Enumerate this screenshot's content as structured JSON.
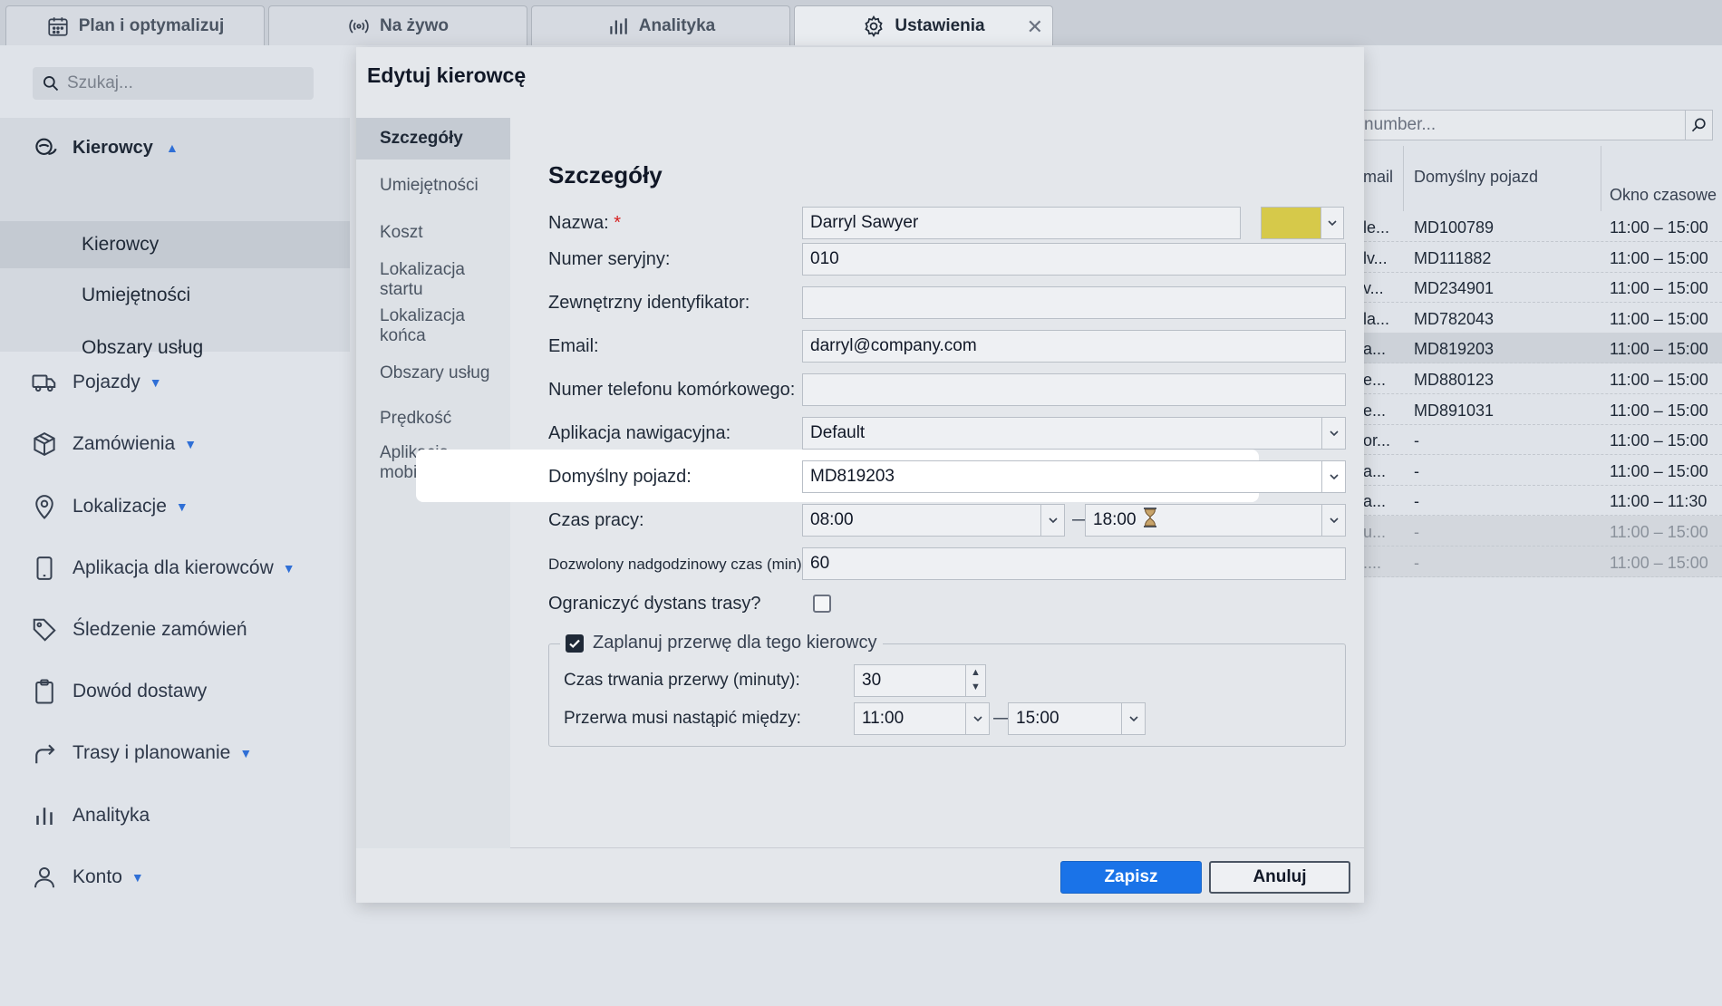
{
  "tabs": [
    {
      "label": "Plan i optymalizuj",
      "icon": "calendar-icon"
    },
    {
      "label": "Na żywo",
      "icon": "broadcast-icon"
    },
    {
      "label": "Analityka",
      "icon": "bar-chart-icon"
    },
    {
      "label": "Ustawienia",
      "icon": "gear-icon",
      "close": "✕"
    }
  ],
  "sidebar": {
    "search_placeholder": "Szukaj...",
    "drivers_label": "Kierowcy",
    "drivers_sub": [
      "Kierowcy",
      "Umiejętności",
      "Obszary usług"
    ],
    "items": [
      {
        "label": "Pojazdy",
        "icon": "truck-icon",
        "caret": true
      },
      {
        "label": "Zamówienia",
        "icon": "box-icon",
        "caret": true
      },
      {
        "label": "Lokalizacje",
        "icon": "map-pin-icon",
        "caret": true
      },
      {
        "label": "Aplikacja dla kierowców",
        "icon": "phone-icon",
        "caret": true
      },
      {
        "label": "Śledzenie zamówień",
        "icon": "tag-icon",
        "caret": false
      },
      {
        "label": "Dowód dostawy",
        "icon": "clipboard-icon",
        "caret": false
      },
      {
        "label": "Trasy i planowanie",
        "icon": "route-arrow-icon",
        "caret": true
      },
      {
        "label": "Analityka",
        "icon": "bar-chart-icon",
        "caret": false
      },
      {
        "label": "Konto",
        "icon": "user-icon",
        "caret": true
      }
    ]
  },
  "bg_table": {
    "search_placeholder": "number...",
    "headers": {
      "email": "mail",
      "vehicle": "Domyślny pojazd",
      "window": "Okno czasowe"
    },
    "rows": [
      {
        "email": "le...",
        "vehicle": "MD100789",
        "window": "11:00 – 15:00"
      },
      {
        "email": "lv...",
        "vehicle": "MD111882",
        "window": "11:00 – 15:00"
      },
      {
        "email": "v...",
        "vehicle": "MD234901",
        "window": "11:00 – 15:00"
      },
      {
        "email": "la...",
        "vehicle": "MD782043",
        "window": "11:00 – 15:00"
      },
      {
        "email": "a...",
        "vehicle": "MD819203",
        "window": "11:00 – 15:00"
      },
      {
        "email": "e...",
        "vehicle": "MD880123",
        "window": "11:00 – 15:00"
      },
      {
        "email": "e...",
        "vehicle": "MD891031",
        "window": "11:00 – 15:00"
      },
      {
        "email": "or...",
        "vehicle": "-",
        "window": "11:00 – 15:00"
      },
      {
        "email": "a...",
        "vehicle": "-",
        "window": "11:00 – 15:00"
      },
      {
        "email": "a...",
        "vehicle": "-",
        "window": "11:00 – 11:30"
      },
      {
        "email": "u...",
        "vehicle": "-",
        "window": "11:00 – 15:00"
      },
      {
        "email": "....",
        "vehicle": "-",
        "window": "11:00 – 15:00"
      }
    ]
  },
  "modal": {
    "title": "Edytuj kierowcę",
    "nav": [
      "Szczegóły",
      "Umiejętności",
      "Koszt",
      "Lokalizacja startu",
      "Lokalizacja końca",
      "Obszary usług",
      "Prędkość",
      "Aplikacja mobilna"
    ],
    "section_title": "Szczegóły",
    "fields": {
      "name_label": "Nazwa:",
      "name_required": "*",
      "name_value": "Darryl Sawyer",
      "color": "#d6c94a",
      "serial_label": "Numer seryjny:",
      "serial_value": "010",
      "external_label": "Zewnętrzny identyfikator:",
      "external_value": "",
      "email_label": "Email:",
      "email_value": "darryl@company.com",
      "phone_label": "Numer telefonu komórkowego:",
      "phone_value": "",
      "nav_app_label": "Aplikacja nawigacyjna:",
      "nav_app_value": "Default",
      "vehicle_label": "Domyślny pojazd:",
      "vehicle_value": "MD819203",
      "work_time_label": "Czas pracy:",
      "work_start": "08:00",
      "work_end": "18:00",
      "dash": "—",
      "overtime_label": "Dozwolony nadgodzinowy czas (min):",
      "overtime_value": "60",
      "limit_distance_label": "Ograniczyć dystans trasy?",
      "limit_distance_checked": false,
      "break_legend": "Zaplanuj przerwę dla tego kierowcy",
      "break_checked": true,
      "break_duration_label": "Czas trwania przerwy (minuty):",
      "break_duration_value": "30",
      "break_between_label": "Przerwa musi nastąpić między:",
      "break_start": "11:00",
      "break_end": "15:00"
    },
    "save_label": "Zapisz",
    "cancel_label": "Anuluj"
  }
}
